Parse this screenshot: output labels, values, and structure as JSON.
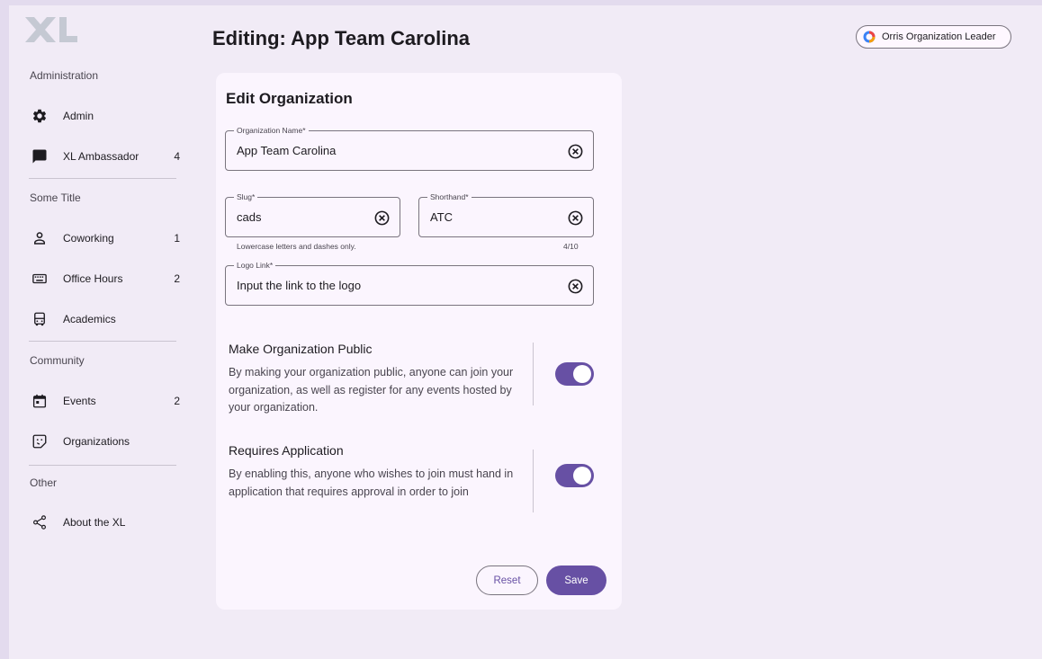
{
  "header": {
    "title": "Editing: App Team Carolina",
    "role_chip": "Orris Organization Leader"
  },
  "sidebar": {
    "logo_text": "XL",
    "sections": [
      {
        "title": "Administration"
      },
      {
        "title": "Some Title"
      },
      {
        "title": "Community"
      },
      {
        "title": "Other"
      }
    ],
    "items": [
      {
        "label": "Admin",
        "badge": "",
        "icon": "gear-icon"
      },
      {
        "label": "XL Ambassador",
        "badge": "4",
        "icon": "chat-icon"
      },
      {
        "label": "Coworking",
        "badge": "1",
        "icon": "person-icon"
      },
      {
        "label": "Office Hours",
        "badge": "2",
        "icon": "keyboard-icon"
      },
      {
        "label": "Academics",
        "badge": "",
        "icon": "bus-icon"
      },
      {
        "label": "Events",
        "badge": "2",
        "icon": "calendar-icon"
      },
      {
        "label": "Organizations",
        "badge": "",
        "icon": "sticker-icon"
      },
      {
        "label": "About the XL",
        "badge": "",
        "icon": "share-icon"
      }
    ]
  },
  "form": {
    "title": "Edit Organization",
    "name": {
      "label": "Organization Name*",
      "value": "App Team Carolina"
    },
    "slug": {
      "label": "Slug*",
      "value": "cads",
      "helper": "Lowercase letters and dashes only."
    },
    "shorthand": {
      "label": "Shorthand*",
      "value": "ATC",
      "counter": "4/10"
    },
    "logo": {
      "label": "Logo Link*",
      "value": "Input the link to the logo"
    },
    "public_setting": {
      "title": "Make Organization Public",
      "description": "By making your organization public, anyone can join your organization, as well as register for any events hosted by your organization.",
      "enabled": true
    },
    "application_setting": {
      "title": "Requires Application",
      "description": "By enabling this, anyone who wishes to join must hand in application that requires approval in order to join",
      "enabled": true
    },
    "reset_label": "Reset",
    "save_label": "Save"
  },
  "colors": {
    "primary": "#6750a4",
    "background": "#f1ebf6",
    "surface": "#fbf5fe",
    "outline": "#79747e"
  }
}
